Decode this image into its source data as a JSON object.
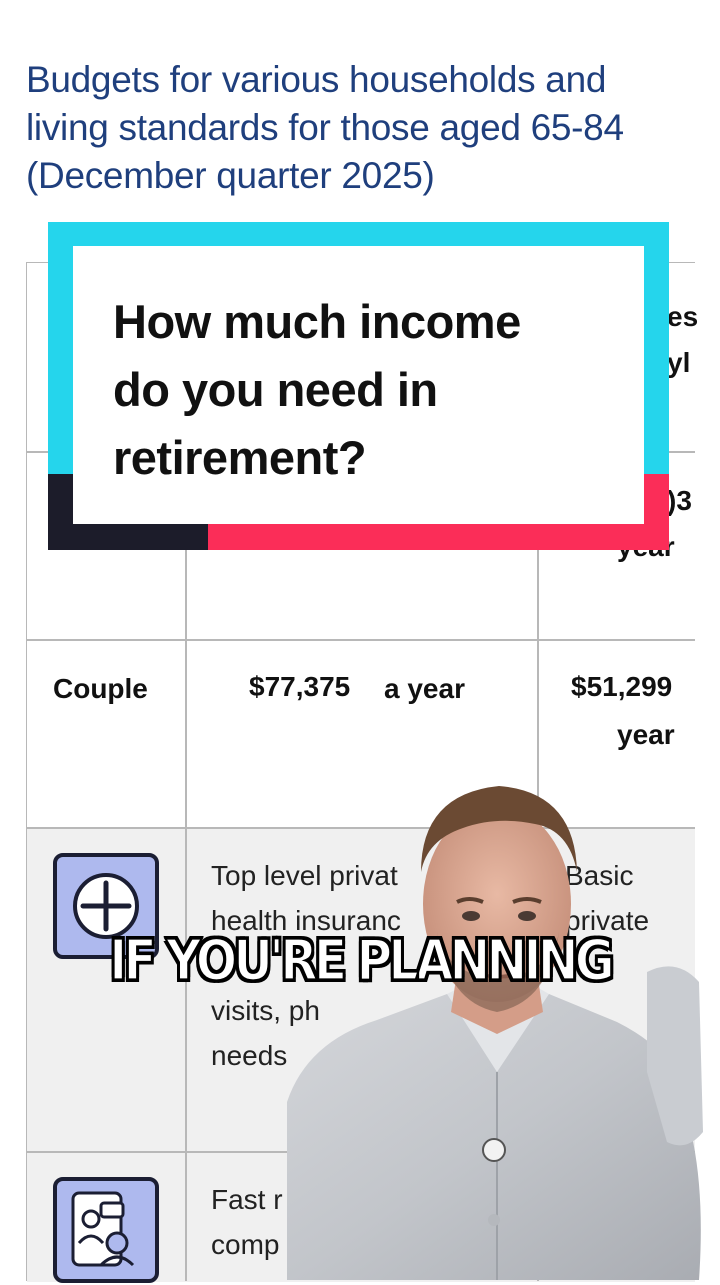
{
  "page": {
    "title_lines": [
      "Budgets for various households and",
      "living standards for those aged 65-84",
      "(December quarter 2025)"
    ]
  },
  "banner": {
    "question_lines": [
      "How much income",
      "do you need in",
      "retirement?"
    ],
    "colors": {
      "cyan": "#25d5ec",
      "dark": "#1c1c2a",
      "red": "#fb2d58"
    }
  },
  "table": {
    "header_partial": {
      "col3_line1": "es",
      "col3_line2": "yl"
    },
    "single_row_partial": {
      "col3_value": ")3",
      "col3_unit": "year"
    },
    "couple_row": {
      "label": "Couple",
      "comfortable_amount": "$77,375",
      "comfortable_unit": "a year",
      "modest_amount": "$51,299",
      "modest_unit": "year"
    },
    "health_row": {
      "icon": "plus-icon",
      "comfortable_lines": [
        "Top level privat",
        "health insuranc",
        "visits, ph",
        "needs"
      ],
      "modest_lines": [
        "Basic",
        "private"
      ]
    },
    "communication_row": {
      "icon": "video-call-icon",
      "comfortable_lines": [
        "Fast r",
        "comp"
      ]
    }
  },
  "video": {
    "caption": "IF YOU'RE PLANNING"
  }
}
